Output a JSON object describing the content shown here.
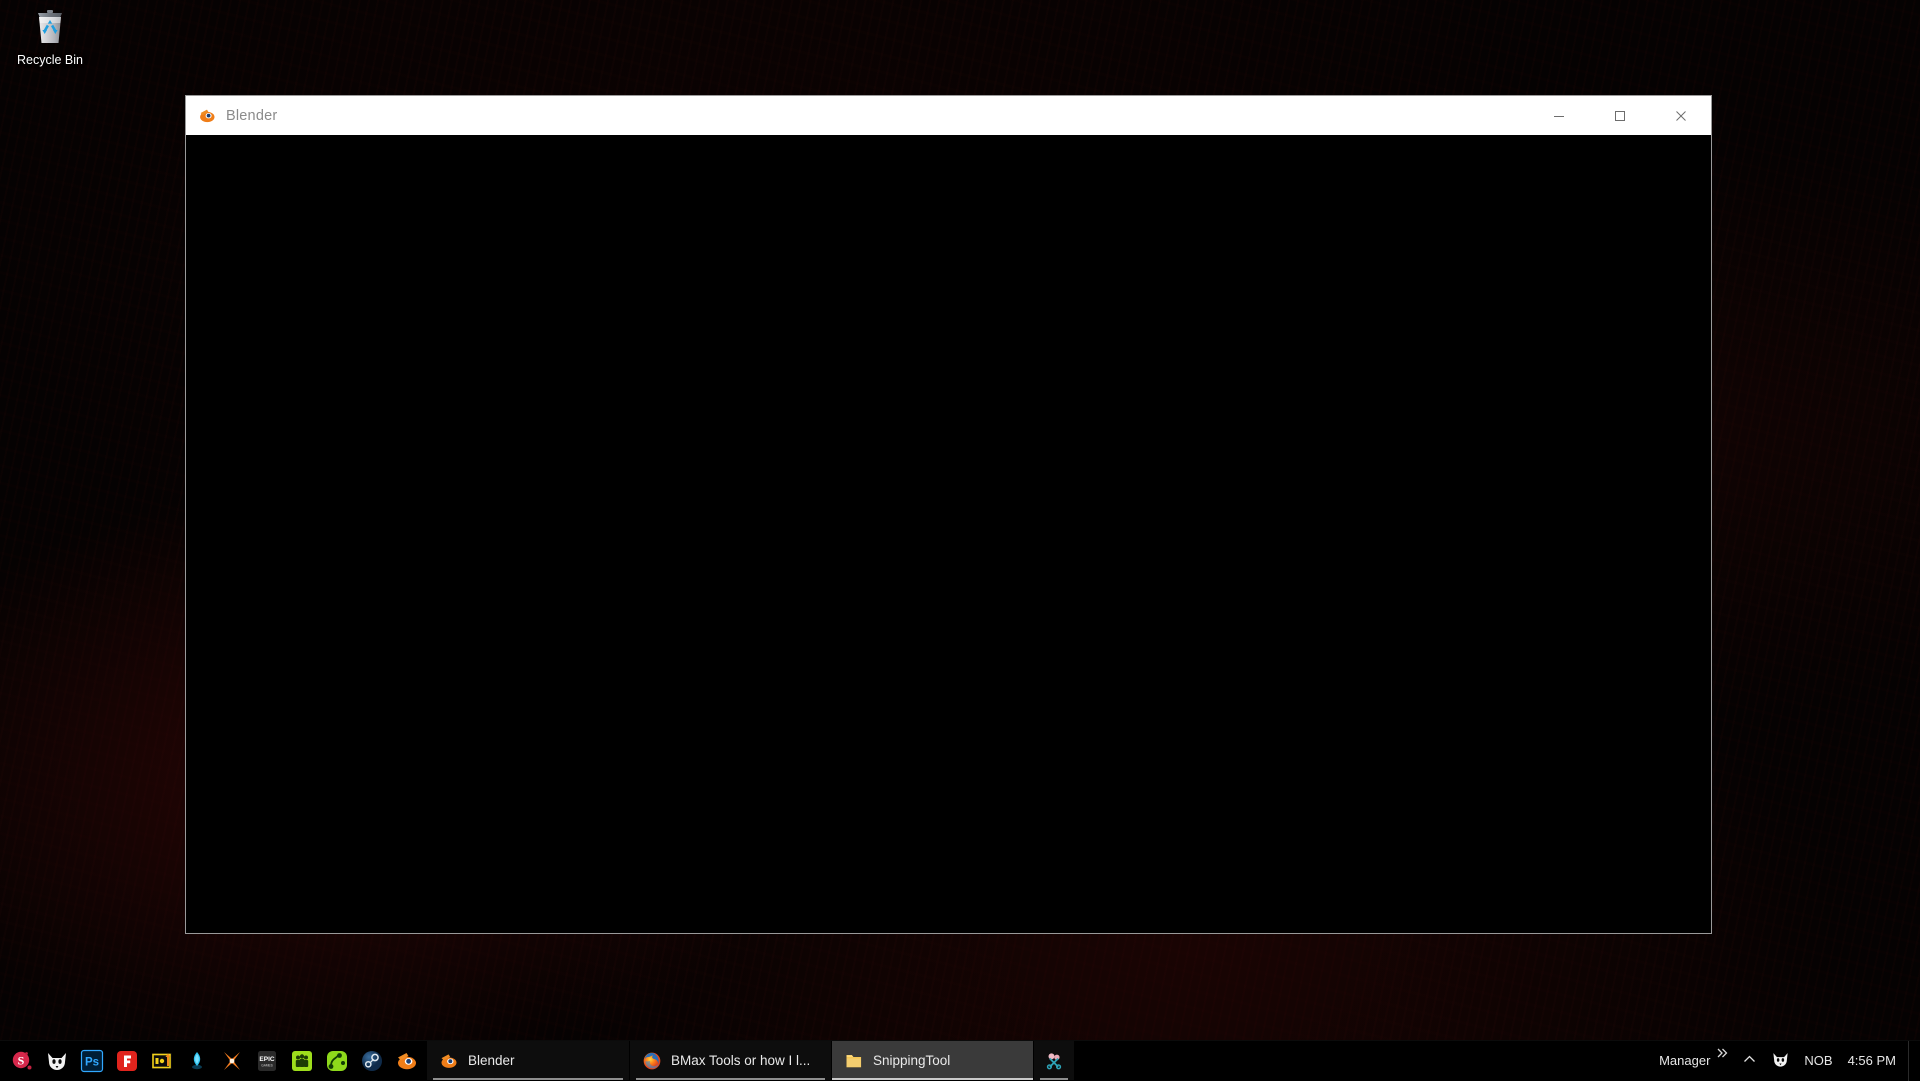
{
  "desktop": {
    "icons": [
      {
        "name": "recycle-bin",
        "label": "Recycle Bin",
        "icon": "recycle-bin-icon"
      }
    ],
    "wallpaper_color": "#050202"
  },
  "window": {
    "title": "Blender",
    "app_icon": "blender-icon",
    "controls": {
      "minimize_label": "Minimize",
      "maximize_label": "Maximize",
      "close_label": "Close"
    },
    "titlebar_bg": "#ffffff",
    "title_color": "#8b8b8b",
    "content_bg": "#000000",
    "border_color": "#9a9a9a"
  },
  "taskbar": {
    "bg": "#000000",
    "quicklaunch": [
      {
        "name": "substance-painter",
        "icon": "red-s-icon",
        "label": "Substance"
      },
      {
        "name": "fox-app",
        "icon": "white-fox-icon",
        "label": "Fox"
      },
      {
        "name": "photoshop",
        "icon": "ps-icon",
        "label": "Ps"
      },
      {
        "name": "f-app",
        "icon": "red-f-icon",
        "label": "F"
      },
      {
        "name": "marmoset-toolbag",
        "icon": "yellow-toolbag-icon",
        "label": "Toolbag"
      },
      {
        "name": "blue-orb-app",
        "icon": "blue-orb-icon",
        "label": "Orb"
      },
      {
        "name": "xnormal",
        "icon": "orange-x-icon",
        "label": "xNormal"
      },
      {
        "name": "epic-games",
        "icon": "epic-icon",
        "label": "EPIC"
      },
      {
        "name": "green-crowd-app",
        "icon": "green-crowd-icon",
        "label": "Crowd"
      },
      {
        "name": "green-node-app",
        "icon": "green-node-icon",
        "label": "Node"
      },
      {
        "name": "steam",
        "icon": "steam-icon",
        "label": "Steam"
      },
      {
        "name": "blender-quicklaunch",
        "icon": "blender-icon",
        "label": "Blender"
      }
    ],
    "buttons": [
      {
        "name": "taskbar-blender",
        "label": "Blender",
        "icon": "blender-icon",
        "active": false,
        "running": true
      },
      {
        "name": "taskbar-firefox",
        "label": "BMax Tools or how I l...",
        "icon": "firefox-icon",
        "active": false,
        "running": true
      },
      {
        "name": "taskbar-snippingtool-folder",
        "label": "SnippingTool",
        "icon": "folder-icon",
        "active": true,
        "running": true
      },
      {
        "name": "taskbar-snipping-tool",
        "label": "",
        "icon": "scissors-icon",
        "active": false,
        "running": true
      }
    ],
    "tray": {
      "manager_label": "Manager",
      "overflow_icon": "double-chevron-right-icon",
      "hidden_icons_label": "Show hidden icons",
      "hidden_icons_icon": "chevron-up-icon",
      "fox_icon": "white-fox-icon",
      "nob_label": "NOB",
      "time": "4:56 PM"
    }
  }
}
